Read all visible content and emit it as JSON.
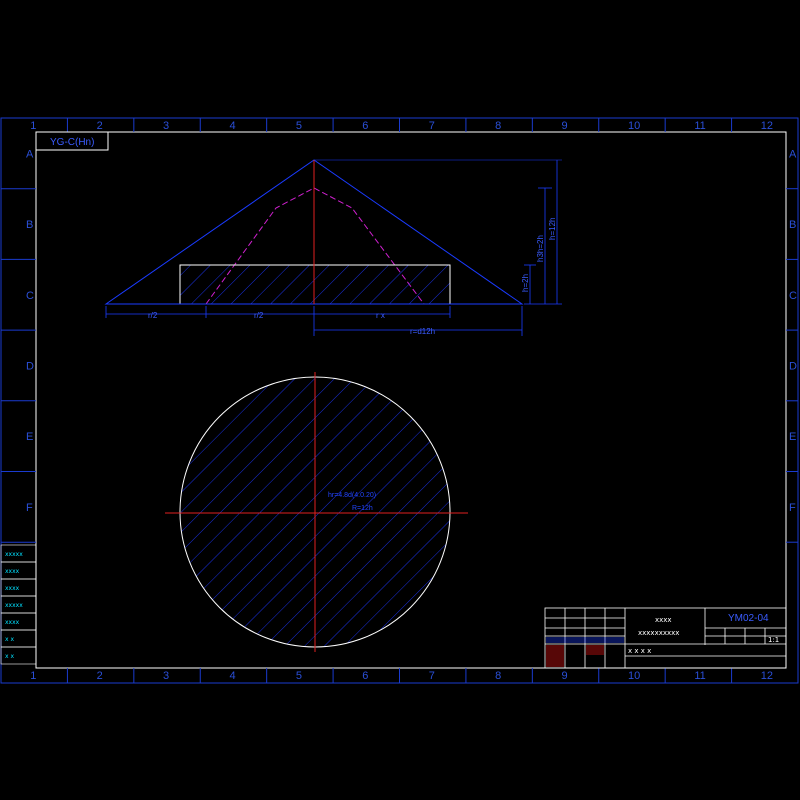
{
  "sheet_tag": "YG-C(Hn)",
  "columns": [
    "1",
    "2",
    "3",
    "4",
    "5",
    "6",
    "7",
    "8",
    "9",
    "10",
    "11",
    "12"
  ],
  "rows": [
    "A",
    "B",
    "C",
    "D",
    "E",
    "F"
  ],
  "dimensions": {
    "half_a": "r/2",
    "half_b": "r/2",
    "rx": "r x",
    "radius_total": "r=d12h",
    "height_low": "h=2h",
    "height_mid": "h3h=2h",
    "height_total": "h=12h"
  },
  "circle_labels": {
    "line1": "hr=4.8d(4.0.20)",
    "line2": "R=12h"
  },
  "title_block": {
    "company": "x x x x",
    "drawing_name_1": "xxxx",
    "drawing_name_2": "xxxxxxxxxx",
    "drawing_code": "YM02-04",
    "scale_label": "1:1"
  },
  "side_cells": [
    "xxxxx",
    "xxxx",
    "xxxx",
    "xxxxx",
    "xxxx",
    "x x",
    "x x"
  ]
}
